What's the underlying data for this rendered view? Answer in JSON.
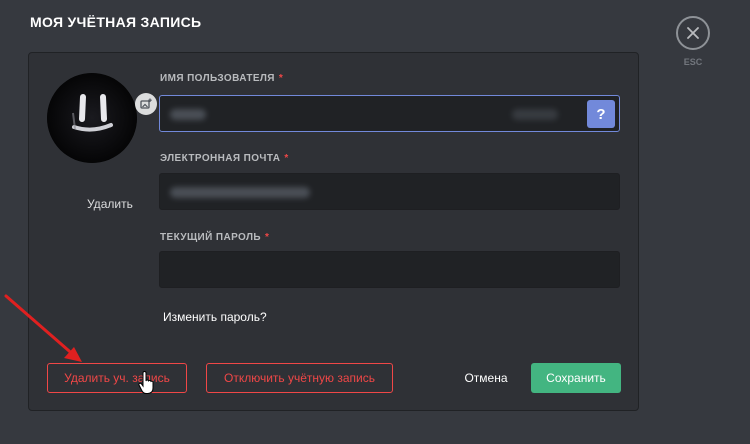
{
  "page": {
    "title": "МОЯ УЧЁТНАЯ ЗАПИСЬ"
  },
  "close": {
    "label": "ESC",
    "icon": "close-icon"
  },
  "avatar": {
    "delete_label": "Удалить",
    "badge_icon": "add-image-icon"
  },
  "fields": {
    "username": {
      "label": "ИМЯ ПОЛЬЗОВАТЕЛЯ",
      "required_mark": "*",
      "help_label": "?"
    },
    "email": {
      "label": "ЭЛЕКТРОННАЯ ПОЧТА",
      "required_mark": "*"
    },
    "password": {
      "label": "ТЕКУЩИЙ ПАРОЛЬ",
      "required_mark": "*"
    }
  },
  "links": {
    "change_password": "Изменить пароль?"
  },
  "actions": {
    "delete_account": "Удалить уч. запись",
    "disable_account": "Отключить учётную запись",
    "cancel": "Отмена",
    "save": "Сохранить"
  },
  "colors": {
    "background": "#36393f",
    "card": "#2f3136",
    "input": "#202225",
    "accent": "#7289da",
    "danger": "#f04747",
    "success": "#43b581"
  }
}
